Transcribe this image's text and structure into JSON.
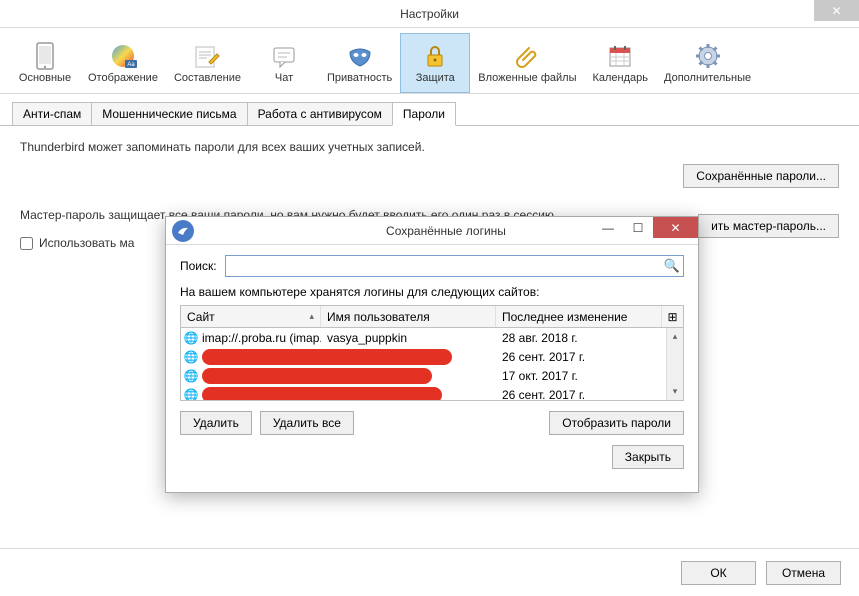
{
  "window": {
    "title": "Настройки"
  },
  "toolbar": {
    "items": [
      {
        "label": "Основные"
      },
      {
        "label": "Отображение"
      },
      {
        "label": "Составление"
      },
      {
        "label": "Чат"
      },
      {
        "label": "Приватность"
      },
      {
        "label": "Защита"
      },
      {
        "label": "Вложенные файлы"
      },
      {
        "label": "Календарь"
      },
      {
        "label": "Дополнительные"
      }
    ]
  },
  "tabs": {
    "items": [
      {
        "label": "Анти-спам"
      },
      {
        "label": "Мошеннические письма"
      },
      {
        "label": "Работа с антивирусом"
      },
      {
        "label": "Пароли"
      }
    ]
  },
  "panel": {
    "remember_text": "Thunderbird может запоминать пароли для всех ваших учетных записей.",
    "saved_passwords_btn": "Сохранённые пароли...",
    "master_text": "Мастер-пароль защищает все ваши пароли, но вам нужно будет вводить его один раз в сессию.",
    "use_master_label": "Использовать ма",
    "change_master_btn": "ить мастер-пароль..."
  },
  "footer": {
    "ok": "ОК",
    "cancel": "Отмена"
  },
  "dialog": {
    "title": "Сохранённые логины",
    "search_label": "Поиск:",
    "desc": "На вашем компьютере хранятся логины для следующих сайтов:",
    "cols": {
      "site": "Сайт",
      "user": "Имя пользователя",
      "date": "Последнее изменение"
    },
    "rows": [
      {
        "site": "imap://.proba.ru (imap...",
        "user": "vasya_puppkin",
        "date": "28 авг. 2018 г.",
        "redacted": false
      },
      {
        "site": "",
        "user": "",
        "date": "26 сент. 2017 г.",
        "redacted": true
      },
      {
        "site": "",
        "user": "",
        "date": "17 окт. 2017 г.",
        "redacted": true
      },
      {
        "site": "",
        "user": "",
        "date": "26 сент. 2017 г.",
        "redacted": true
      }
    ],
    "delete": "Удалить",
    "delete_all": "Удалить все",
    "show_pw": "Отобразить пароли",
    "close": "Закрыть"
  }
}
